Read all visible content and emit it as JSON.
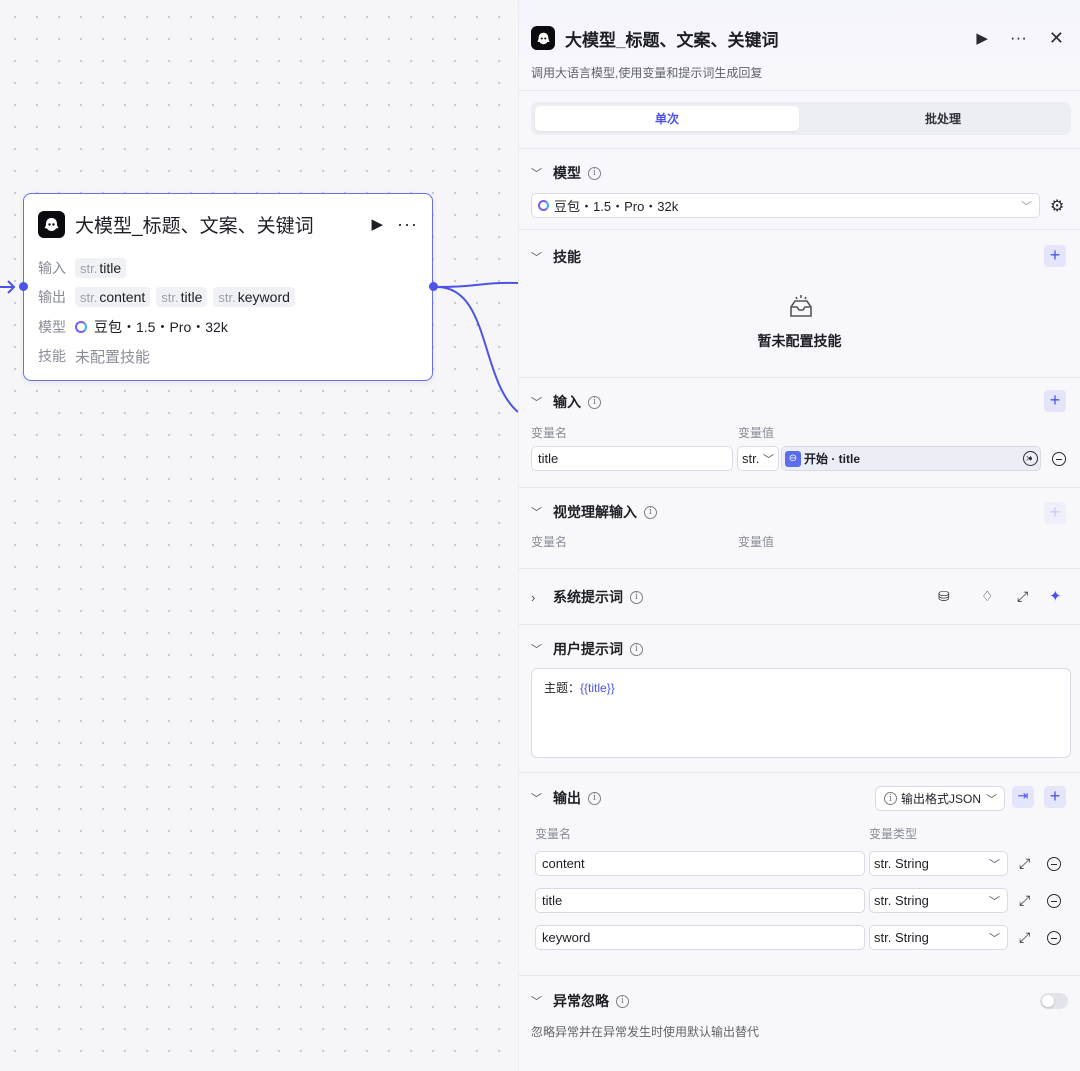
{
  "node": {
    "title": "大模型_标题、文案、关键词",
    "input_label": "输入",
    "output_label": "输出",
    "model_label": "模型",
    "skills_label": "技能",
    "type_prefix": "str.",
    "inputs": [
      "title"
    ],
    "outputs": [
      "content",
      "title",
      "keyword"
    ],
    "model_name": "豆包・1.5・Pro・32k",
    "skills_value": "未配置技能"
  },
  "panel": {
    "title": "大模型_标题、文案、关键词",
    "description": "调用大语言模型,使用变量和提示词生成回复",
    "tabs": {
      "single": "单次",
      "batch": "批处理"
    },
    "model": {
      "title": "模型",
      "value": "豆包・1.5・Pro・32k"
    },
    "skills": {
      "title": "技能",
      "empty": "暂未配置技能"
    },
    "inputs": {
      "title": "输入",
      "col_name": "变量名",
      "col_value": "变量值",
      "row": {
        "name": "title",
        "type": "str.",
        "ref_source": "开始 · title"
      }
    },
    "vision": {
      "title": "视觉理解输入",
      "col_name": "变量名",
      "col_value": "变量值"
    },
    "system_prompt": {
      "title": "系统提示词"
    },
    "user_prompt": {
      "title": "用户提示词",
      "prefix": "主题：",
      "var": "{{title}}"
    },
    "outputs": {
      "title": "输出",
      "format": "输出格式JSON",
      "col_name": "变量名",
      "col_type": "变量类型",
      "rows": [
        {
          "name": "content",
          "type": "str. String"
        },
        {
          "name": "title",
          "type": "str. String"
        },
        {
          "name": "keyword",
          "type": "str. String"
        }
      ]
    },
    "error_ignore": {
      "title": "异常忽略",
      "description": "忽略异常并在异常发生时使用默认输出替代"
    }
  },
  "colors": {
    "accent": "#4d53e8",
    "node_border": "#6a6ef0"
  },
  "icons": [
    "bot-icon",
    "run-icon",
    "more-icon",
    "close-icon",
    "info-icon",
    "gear-icon",
    "plus-icon",
    "empty-box-icon",
    "chevron-down-icon",
    "chevron-right-icon",
    "expand-icon",
    "minus-circle-icon",
    "bulb-icon",
    "sparkle-icon",
    "library-icon",
    "target-icon",
    "clear-icon",
    "import-icon"
  ]
}
